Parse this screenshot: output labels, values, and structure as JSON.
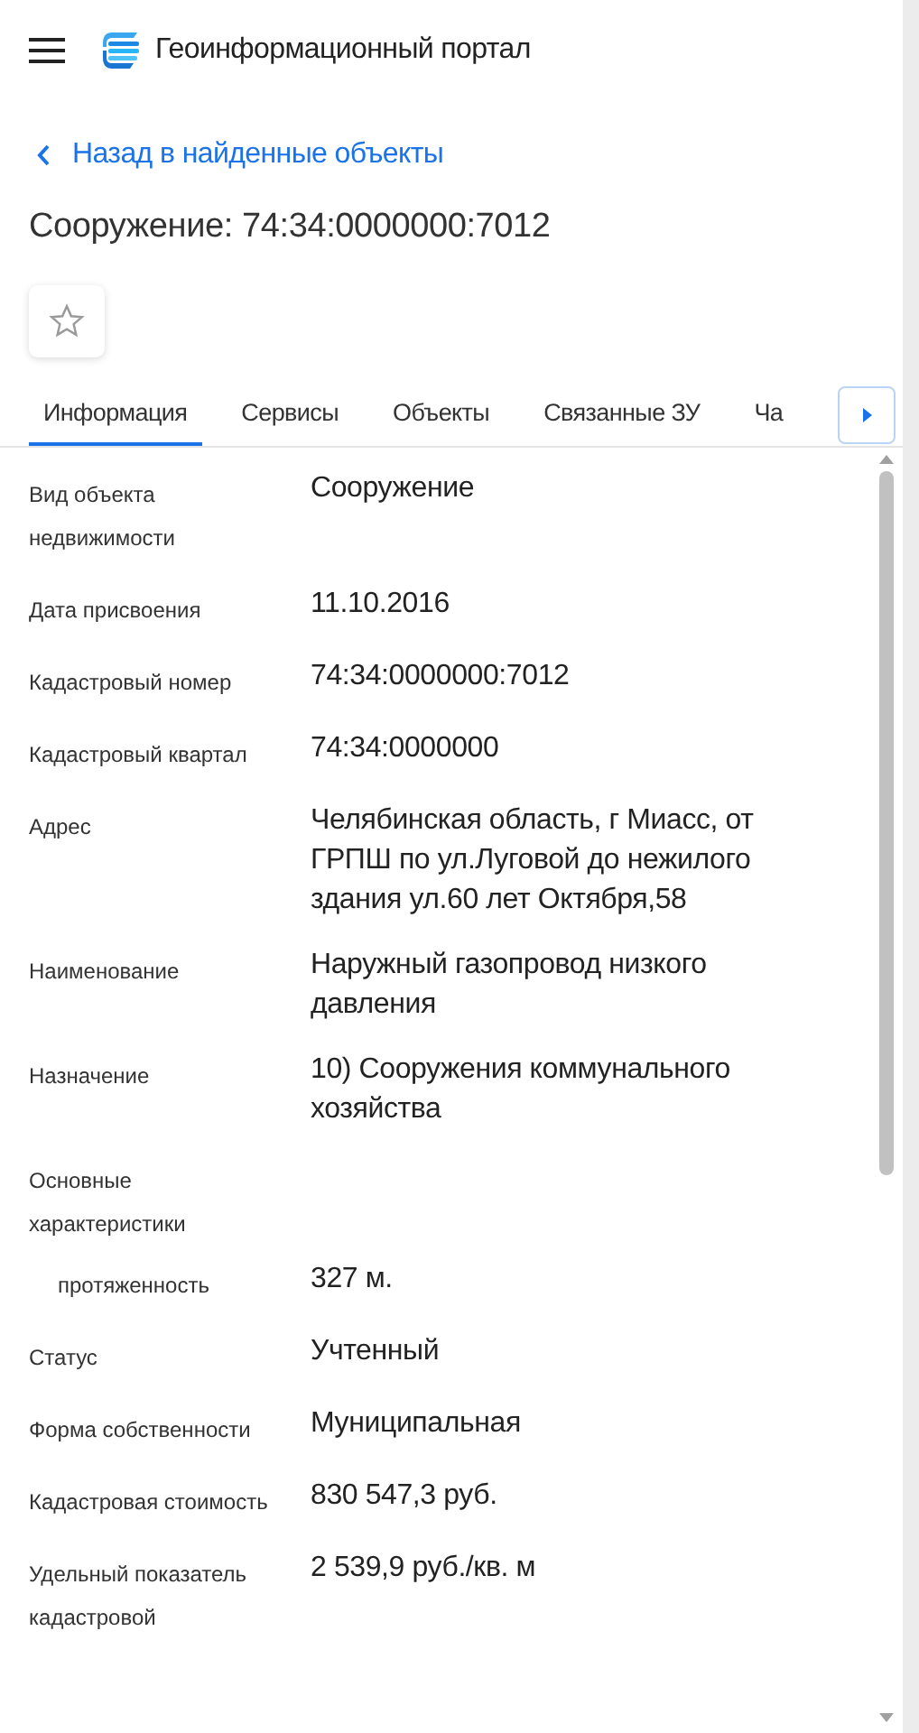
{
  "header": {
    "title": "Геоинформационный портал"
  },
  "back_link": {
    "label": "Назад в найденные объекты"
  },
  "object_title": "Сооружение: 74:34:0000000:7012",
  "favorite": {
    "selected": false
  },
  "tabs": [
    {
      "label": "Информация",
      "selected": true
    },
    {
      "label": "Сервисы",
      "selected": false
    },
    {
      "label": "Объекты",
      "selected": false
    },
    {
      "label": "Связанные ЗУ",
      "selected": false
    },
    {
      "label": "Ча",
      "selected": false
    }
  ],
  "fields": [
    {
      "kind": "field",
      "label": "Вид объекта недвижимости",
      "value": "Сооружение"
    },
    {
      "kind": "field",
      "label": "Дата присвоения",
      "value": "11.10.2016"
    },
    {
      "kind": "field",
      "label": "Кадастровый номер",
      "value": "74:34:0000000:7012"
    },
    {
      "kind": "field",
      "label": "Кадастровый квартал",
      "value": "74:34:0000000"
    },
    {
      "kind": "field",
      "label": "Адрес",
      "value": "Челябинская область, г Миасс, от ГРПШ по ул.Луговой до нежилого здания ул.60 лет Октября,58"
    },
    {
      "kind": "field",
      "label": "Наименование",
      "value": "Наружный газопровод низкого давления"
    },
    {
      "kind": "field",
      "label": "Назначение",
      "value": "10) Сооружения коммунального хозяйства"
    },
    {
      "kind": "group",
      "label": "Основные характеристики"
    },
    {
      "kind": "sub",
      "label": "протяженность",
      "value": "327 м."
    },
    {
      "kind": "field",
      "label": "Статус",
      "value": "Учтенный"
    },
    {
      "kind": "field",
      "label": "Форма собственности",
      "value": "Муниципальная"
    },
    {
      "kind": "field",
      "label": "Кадастровая стоимость",
      "value": "830 547,3 руб."
    },
    {
      "kind": "field",
      "label": "Удельный показатель кадастровой",
      "value": "2 539,9 руб./кв. м"
    }
  ]
}
